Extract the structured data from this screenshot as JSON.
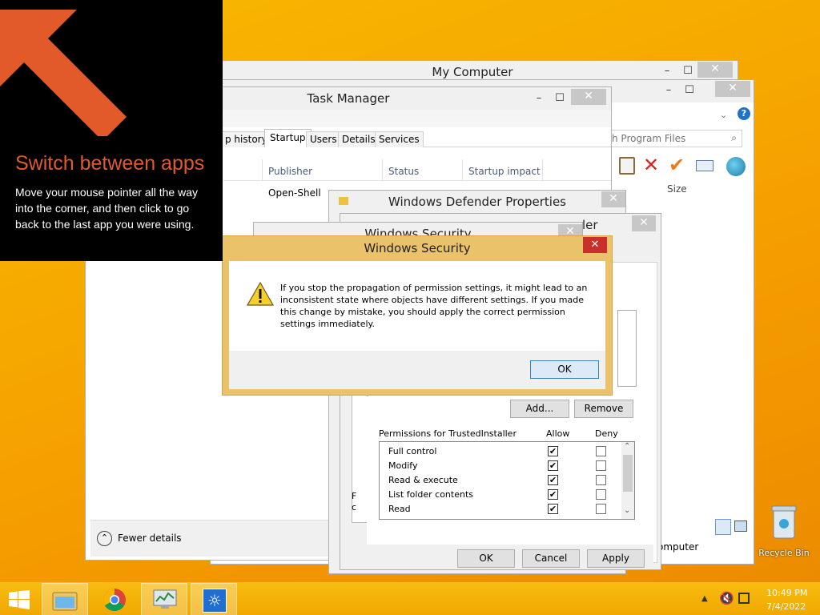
{
  "tip": {
    "heading": "Switch between apps",
    "body": "Move your mouse pointer all the way into the corner, and then click to go back to the last app you were using."
  },
  "my_computer": {
    "title": "My Computer",
    "search_placeholder": "h Program Files",
    "col_size": "Size",
    "status_text": "omputer"
  },
  "task_manager": {
    "title": "Task Manager",
    "tabs": [
      "p history",
      "Startup",
      "Users",
      "Details",
      "Services"
    ],
    "columns": [
      "Publisher",
      "Status",
      "Startup impact"
    ],
    "row_publisher": "Open-Shell",
    "fewer_details": "Fewer details"
  },
  "defender": {
    "title": "Windows Defender Properties",
    "inner_title_fragment": "ler",
    "add_label": "Add...",
    "remove_label": "Remove",
    "perm_header": "Permissions for TrustedInstaller",
    "allow_label": "Allow",
    "deny_label": "Deny",
    "permissions": [
      {
        "name": "Full control",
        "allow": "✔",
        "deny": ""
      },
      {
        "name": "Modify",
        "allow": "✔",
        "deny": ""
      },
      {
        "name": "Read & execute",
        "allow": "✔",
        "deny": ""
      },
      {
        "name": "List folder contents",
        "allow": "✔",
        "deny": ""
      },
      {
        "name": "Read",
        "allow": "✔",
        "deny": ""
      }
    ],
    "ok_label": "OK",
    "cancel_label": "Cancel",
    "apply_label": "Apply",
    "left_frag_1": "F",
    "left_frag_2": "c"
  },
  "behind_security": {
    "title": "Windows Security"
  },
  "dialog": {
    "title": "Windows Security",
    "message": "If you stop the propagation of permission settings, it might lead to an inconsistent state where objects have different settings. If you made this change by mistake, you should apply the correct permission settings immediately.",
    "ok_label": "OK"
  },
  "desktop": {
    "recycle_bin_label": "Recycle Bin"
  },
  "taskbar": {
    "time": "10:49 PM",
    "date": "7/4/2022"
  },
  "icons": {
    "start": "windows-logo",
    "file_explorer": "folder",
    "chrome": "chrome",
    "task_manager": "monitor-chart",
    "settings": "gear-sun"
  },
  "colors": {
    "desktop": "#f6a800",
    "taskbar": "#f6b400",
    "tip_bg": "#000000",
    "tip_arrow": "#e25a2a",
    "tip_heading": "#e25a2a",
    "dialog_border": "#e8b84a",
    "close_red": "#c9302c",
    "selected_button": "#dceaf7"
  }
}
